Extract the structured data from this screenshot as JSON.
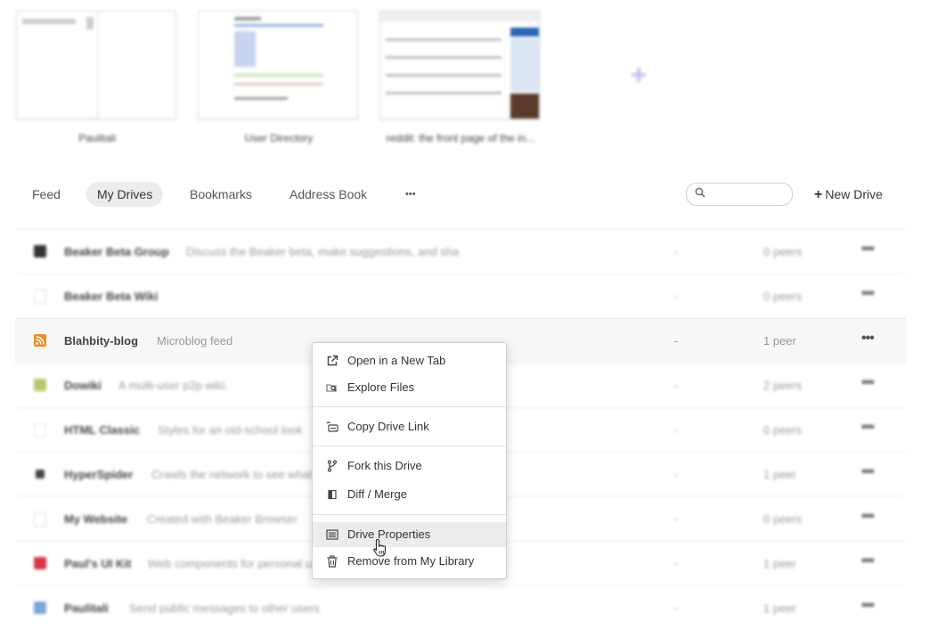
{
  "pinned": [
    {
      "title": "Paulitali"
    },
    {
      "title": "User Directory"
    },
    {
      "title": "reddit: the front page of the in..."
    }
  ],
  "nav": {
    "tabs": [
      {
        "label": "Feed"
      },
      {
        "label": "My Drives",
        "active": true
      },
      {
        "label": "Bookmarks"
      },
      {
        "label": "Address Book"
      },
      {
        "label": "•••"
      }
    ],
    "search_placeholder": "",
    "new_drive_label": "New Drive"
  },
  "drives": [
    {
      "title": "Beaker Beta Group",
      "description": "Discuss the Beaker beta, make suggestions, and sha",
      "size": "-",
      "peers": "0 peers",
      "icon_color": "#333333"
    },
    {
      "title": "Beaker Beta Wiki",
      "description": "",
      "size": "-",
      "peers": "0 peers",
      "icon_color": "#dddddd"
    },
    {
      "title": "Blahbity-blog",
      "description": "Microblog feed",
      "size": "-",
      "peers": "1 peer",
      "icon_color": "#f08c2b"
    },
    {
      "title": "Dowiki",
      "description": "A multi-user p2p wiki.",
      "size": "-",
      "peers": "2 peers",
      "icon_color": "#b9c86a"
    },
    {
      "title": "HTML Classic",
      "description": "Styles for an old-school look",
      "size": "-",
      "peers": "0 peers",
      "icon_color": "#dddddd"
    },
    {
      "title": "HyperSpider",
      "description": "Crawls the network to see what's out there",
      "size": "-",
      "peers": "1 peer",
      "icon_color": "#444444"
    },
    {
      "title": "My Website",
      "description": "Created with Beaker Browser",
      "size": "-",
      "peers": "0 peers",
      "icon_color": "#dddddd"
    },
    {
      "title": "Paul's UI Kit",
      "description": "Web components for personal use",
      "size": "-",
      "peers": "1 peer",
      "icon_color": "#d9334a"
    },
    {
      "title": "Paulitali",
      "description": "Send public messages to other users",
      "size": "-",
      "peers": "1 peer",
      "icon_color": "#7aa6d6"
    }
  ],
  "row_more_label": "•••",
  "context_menu": {
    "items": [
      {
        "label": "Open in a New Tab",
        "icon": "external-link-icon"
      },
      {
        "label": "Explore Files",
        "icon": "folder-search-icon"
      },
      {
        "label": "Copy Drive Link",
        "icon": "copy-link-icon"
      },
      {
        "label": "Fork this Drive",
        "icon": "fork-icon"
      },
      {
        "label": "Diff / Merge",
        "icon": "diff-icon"
      },
      {
        "label": "Drive Properties",
        "icon": "properties-icon",
        "hovered": true
      },
      {
        "label": "Remove from My Library",
        "icon": "trash-icon"
      }
    ]
  },
  "colors": {
    "accent_add": "#c9c2f0",
    "active_tab_bg": "#ececec",
    "rss": "#f08c2b"
  }
}
